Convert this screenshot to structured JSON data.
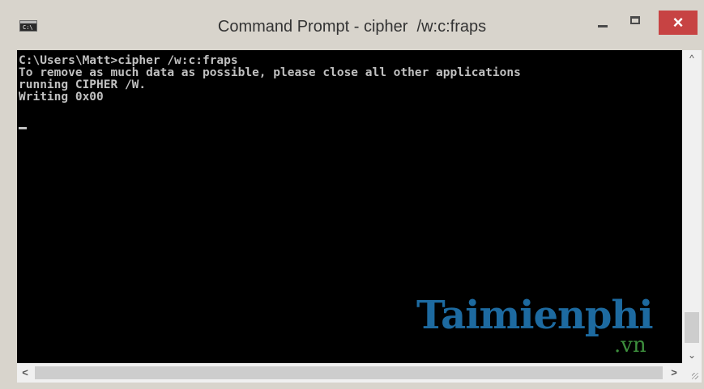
{
  "window": {
    "title": "Command Prompt - cipher  /w:c:fraps",
    "icon": "cmd-icon",
    "controls": {
      "minimize": "minimize-icon",
      "maximize": "maximize-icon",
      "close_label": "×"
    }
  },
  "console": {
    "lines": [
      "C:\\Users\\Matt>cipher /w:c:fraps",
      "To remove as much data as possible, please close all other applications",
      "running CIPHER /W.",
      "Writing 0x00"
    ],
    "text_color": "#c0c0c0",
    "background_color": "#000000"
  },
  "watermark": {
    "brand": "Taimienphi",
    "suffix": ".vn",
    "brand_color": "#1d6aa0",
    "suffix_color": "#3d8f3d"
  },
  "scrollbars": {
    "up_arrow": "^",
    "down_arrow": "⌄",
    "left_arrow": "<",
    "right_arrow": ">"
  },
  "colors": {
    "titlebar": "#d8d4cc",
    "close_button": "#c74343"
  }
}
